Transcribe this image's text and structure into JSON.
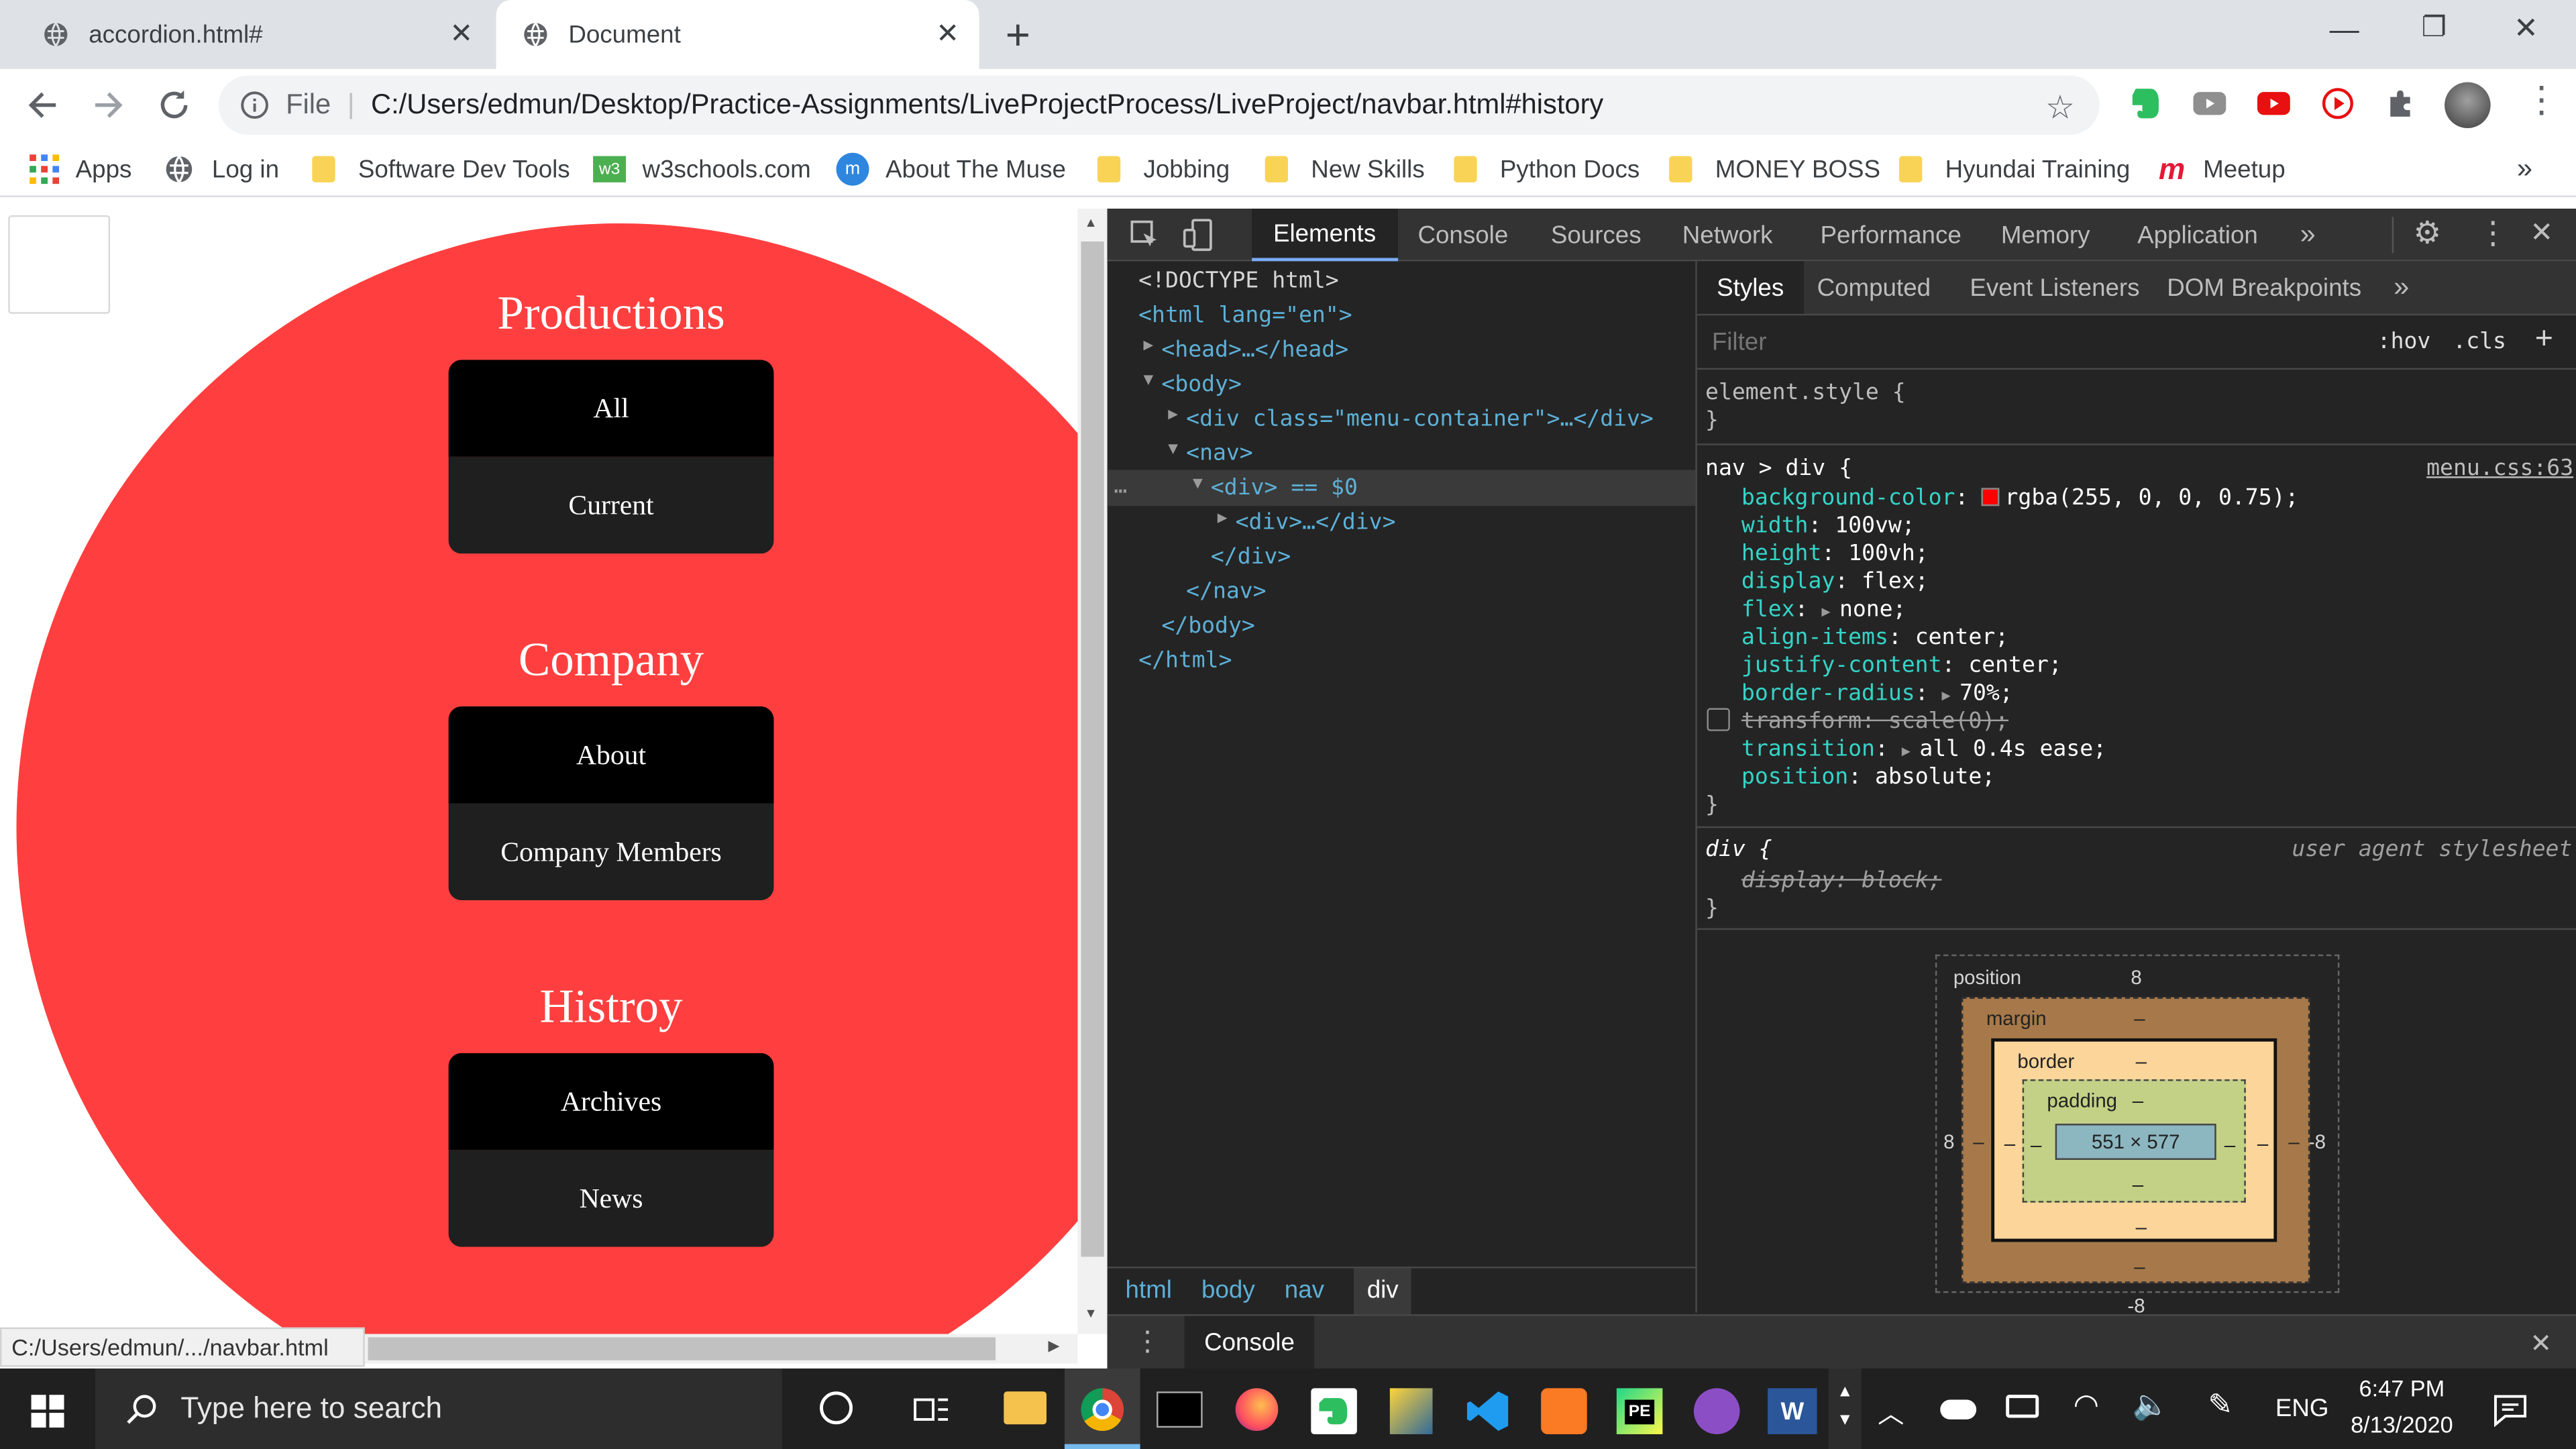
{
  "browser": {
    "tabs": [
      {
        "title": "accordion.html#",
        "active": false
      },
      {
        "title": "Document",
        "active": true
      }
    ],
    "new_tab": "+",
    "window": {
      "minimize": "—",
      "maximize": "❐",
      "close": "✕"
    },
    "omnibox": {
      "scheme_label": "File",
      "url": "C:/Users/edmun/Desktop/Practice-Assignments/LiveProjectProcess/LiveProject/navbar.html#history"
    },
    "bookmarks": [
      "Apps",
      "Log in",
      "Software Dev Tools",
      "w3schools.com",
      "About The Muse",
      "Jobbing",
      "New Skills",
      "Python Docs",
      "MONEY BOSS",
      "Hyundai Training",
      "Meetup"
    ],
    "bookmarks_more": "»",
    "status_url": "C:/Users/edmun/.../navbar.html"
  },
  "page": {
    "sections": [
      {
        "title": "Productions",
        "items": [
          "All",
          "Current"
        ]
      },
      {
        "title": "Company",
        "items": [
          "About",
          "Company Members"
        ]
      },
      {
        "title": "Histroy",
        "items": [
          "Archives",
          "News"
        ]
      }
    ],
    "circle_color": "#ff3f3f"
  },
  "devtools": {
    "tabs": [
      "Elements",
      "Console",
      "Sources",
      "Network",
      "Performance",
      "Memory",
      "Application"
    ],
    "active_tab": "Elements",
    "tabs_more": "»",
    "dom": [
      "<!DOCTYPE html>",
      "<html lang=\"en\">",
      "<head>…</head>",
      "<body>",
      "<div class=\"menu-container\">…</div>",
      "<nav>",
      "<div> == $0",
      "<div>…</div>",
      "</div>",
      "</nav>",
      "</body>",
      "</html>"
    ],
    "breadcrumbs": [
      "html",
      "body",
      "nav",
      "div"
    ],
    "style_tabs": [
      "Styles",
      "Computed",
      "Event Listeners",
      "DOM Breakpoints"
    ],
    "style_tabs_more": "»",
    "filter_placeholder": "Filter",
    "hov": ":hov",
    "cls": ".cls",
    "add": "+",
    "element_style": "element.style {",
    "rule_selector": "nav > div {",
    "rule_source": "menu.css:63",
    "declarations": [
      {
        "prop": "background-color",
        "value": "rgba(255, 0, 0, 0.75);"
      },
      {
        "prop": "width",
        "value": "100vw;"
      },
      {
        "prop": "height",
        "value": "100vh;"
      },
      {
        "prop": "display",
        "value": "flex;"
      },
      {
        "prop": "flex",
        "value": "none;"
      },
      {
        "prop": "align-items",
        "value": "center;"
      },
      {
        "prop": "justify-content",
        "value": "center;"
      },
      {
        "prop": "border-radius",
        "value": "70%;"
      },
      {
        "prop": "transform",
        "value": "scale(0);",
        "struck": true
      },
      {
        "prop": "transition",
        "value": "all 0.4s ease;"
      },
      {
        "prop": "position",
        "value": "absolute;"
      }
    ],
    "ua_selector": "div {",
    "ua_source": "user agent stylesheet",
    "ua_decl": "display: block;",
    "box_model": {
      "position_label": "position",
      "position_top": "8",
      "position_left": "8",
      "position_right": "-8",
      "position_bottom": "-8",
      "margin_label": "margin",
      "border_label": "border",
      "padding_label": "padding",
      "dash": "–",
      "content": "551 × 577"
    },
    "console_drawer": "Console",
    "swatch_color": "#ff0000"
  },
  "taskbar": {
    "search_placeholder": "Type here to search",
    "lang": "ENG",
    "time": "6:47 PM",
    "date": "8/13/2020"
  }
}
